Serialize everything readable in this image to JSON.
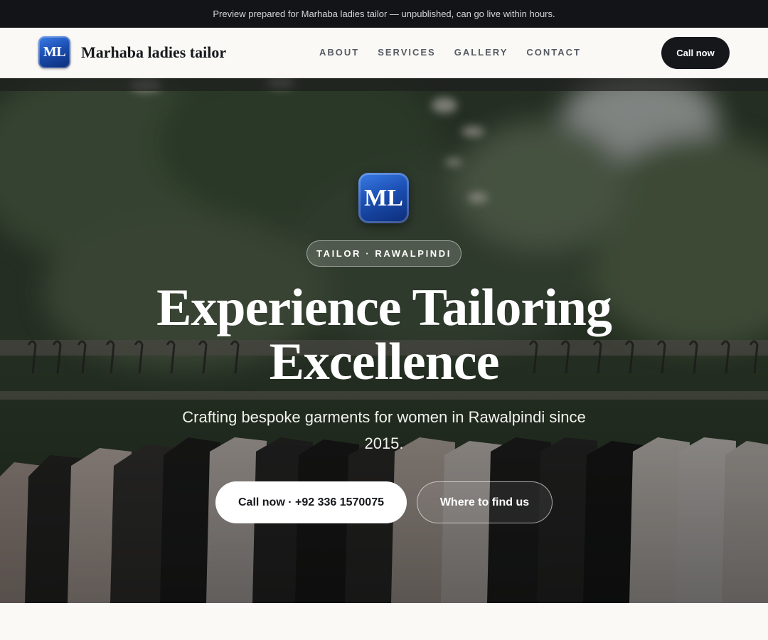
{
  "banner": {
    "text": "Preview prepared for Marhaba ladies tailor — unpublished, can go live within hours."
  },
  "header": {
    "logo_text": "ML",
    "brand_name": "Marhaba ladies tailor",
    "nav": [
      "ABOUT",
      "SERVICES",
      "GALLERY",
      "CONTACT"
    ],
    "cta_label": "Call now"
  },
  "hero": {
    "logo_text": "ML",
    "pill_text": "TAILOR · RAWALPINDI",
    "headline": "Experience Tailoring Excellence",
    "subline": "Crafting bespoke garments for women in Rawalpindi since 2015.",
    "primary_button": "Call now · +92 336 1570075",
    "secondary_button": "Where to find us"
  },
  "colors": {
    "topbar_bg": "#121417",
    "nav_bg": "#faf9f6",
    "dark_button": "#15171b",
    "logo_blue": "#1b4fb3"
  }
}
